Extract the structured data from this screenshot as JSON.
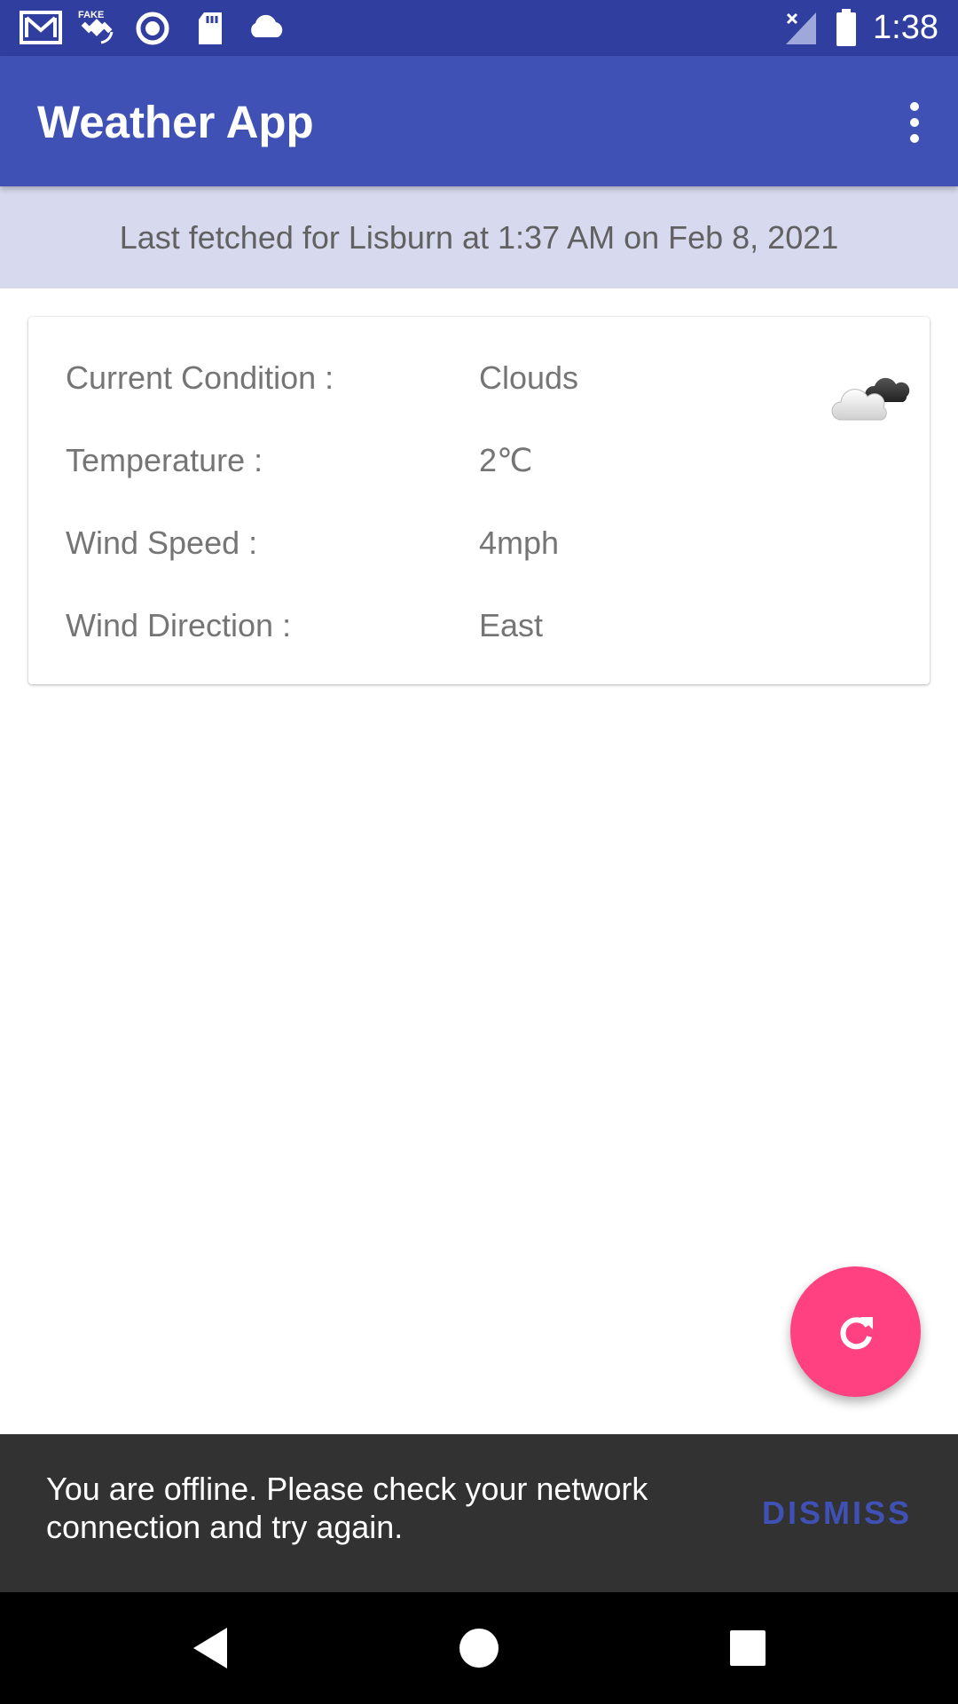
{
  "status_bar": {
    "time": "1:38",
    "icons": [
      "gmail-icon",
      "fake-gps-icon",
      "record-icon",
      "sd-card-icon",
      "cloud-icon",
      "signal-icon",
      "battery-icon"
    ]
  },
  "app_bar": {
    "title": "Weather App",
    "overflow_icon": "more-vert-icon"
  },
  "banner": {
    "text": "Last fetched for Lisburn at 1:37 AM on Feb 8, 2021"
  },
  "weather": {
    "rows": [
      {
        "label": "Current Condition :",
        "value": "Clouds"
      },
      {
        "label": "Temperature :",
        "value": "2℃"
      },
      {
        "label": "Wind Speed :",
        "value": "4mph"
      },
      {
        "label": "Wind Direction :",
        "value": "East"
      }
    ],
    "icon": "clouds-icon"
  },
  "fab": {
    "icon": "refresh-icon"
  },
  "snackbar": {
    "message": "You are offline. Please check your network connection and try again.",
    "action": "DISMISS"
  },
  "nav": {
    "icons": [
      "back-icon",
      "home-icon",
      "recents-icon"
    ]
  },
  "colors": {
    "primary_dark": "#303f9f",
    "primary": "#3f51b5",
    "accent": "#ff4081",
    "banner_bg": "#d7daee",
    "snackbar_bg": "#323232"
  }
}
